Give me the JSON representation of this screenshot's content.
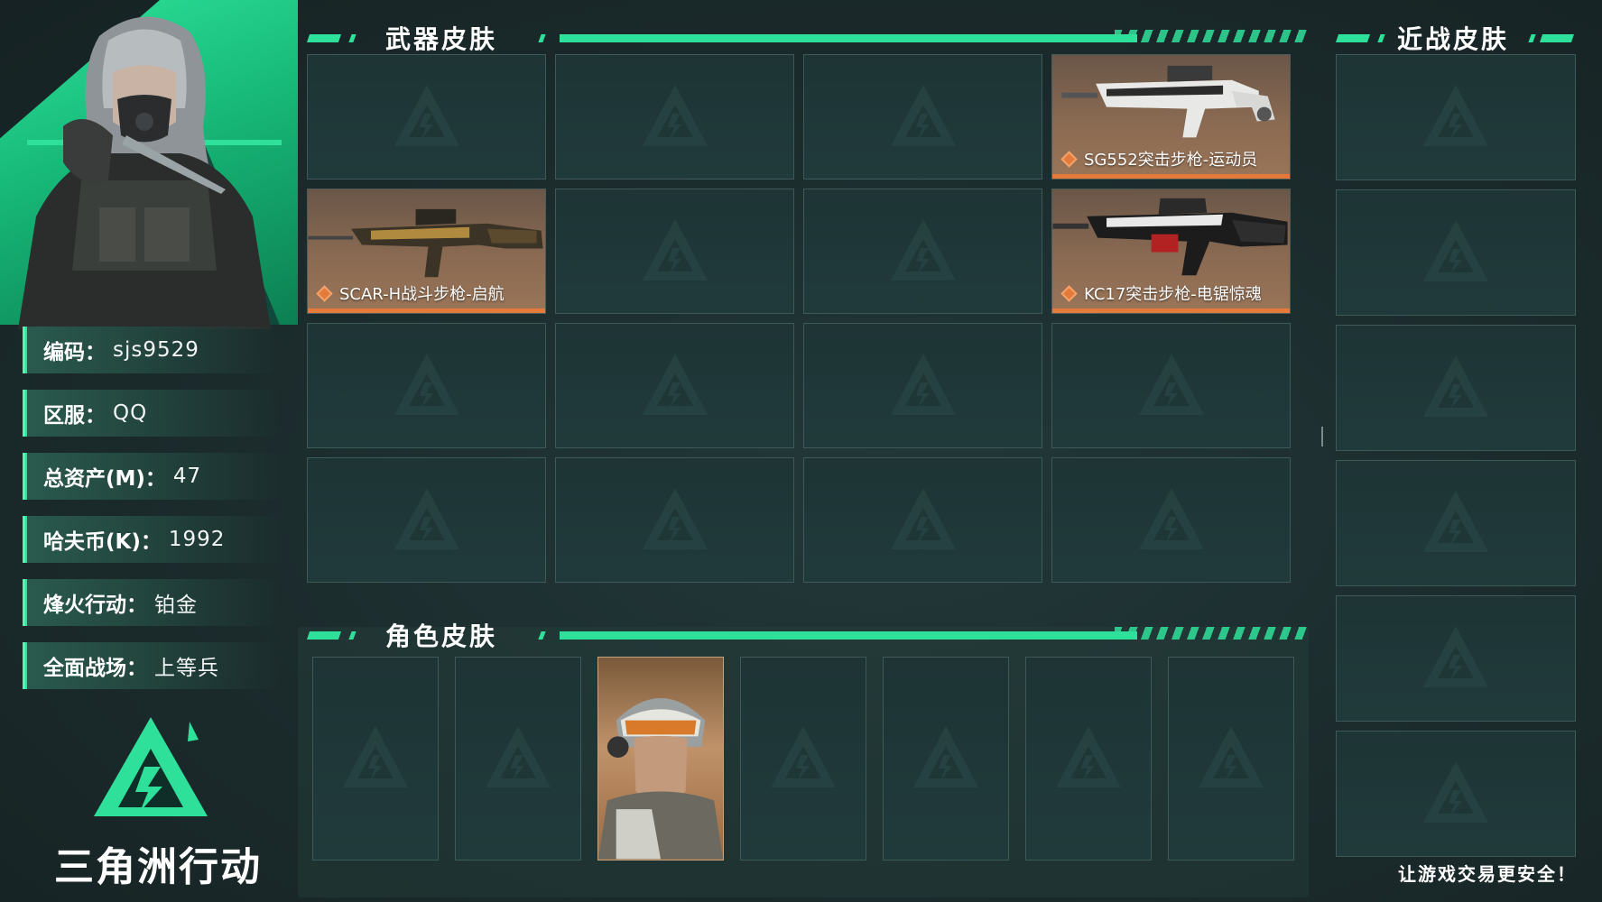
{
  "profile": {
    "rows": [
      {
        "label": "编码",
        "value": "sjs9529"
      },
      {
        "label": "区服",
        "value": "QQ"
      },
      {
        "label": "总资产(M)",
        "value": "47"
      },
      {
        "label": "哈夫币(K)",
        "value": "1992"
      },
      {
        "label": "烽火行动",
        "value": "铂金"
      },
      {
        "label": "全面战场",
        "value": "上等兵"
      }
    ],
    "colon": "："
  },
  "logo": {
    "text": "三角洲行动"
  },
  "sections": {
    "weapon": {
      "title": "武器皮肤"
    },
    "melee": {
      "title": "近战皮肤"
    },
    "character": {
      "title": "角色皮肤"
    }
  },
  "weapon_skins": [
    {
      "name": ""
    },
    {
      "name": ""
    },
    {
      "name": ""
    },
    {
      "name": "SG552突击步枪-运动员"
    },
    {
      "name": "SCAR-H战斗步枪-启航"
    },
    {
      "name": ""
    },
    {
      "name": ""
    },
    {
      "name": "KC17突击步枪-电锯惊魂"
    },
    {
      "name": ""
    },
    {
      "name": ""
    },
    {
      "name": ""
    },
    {
      "name": ""
    },
    {
      "name": ""
    },
    {
      "name": ""
    },
    {
      "name": ""
    },
    {
      "name": ""
    }
  ],
  "tagline": "让游戏交易更安全！",
  "colors": {
    "accent": "#2fe09a",
    "rarity_orange": "#e57b3a"
  }
}
